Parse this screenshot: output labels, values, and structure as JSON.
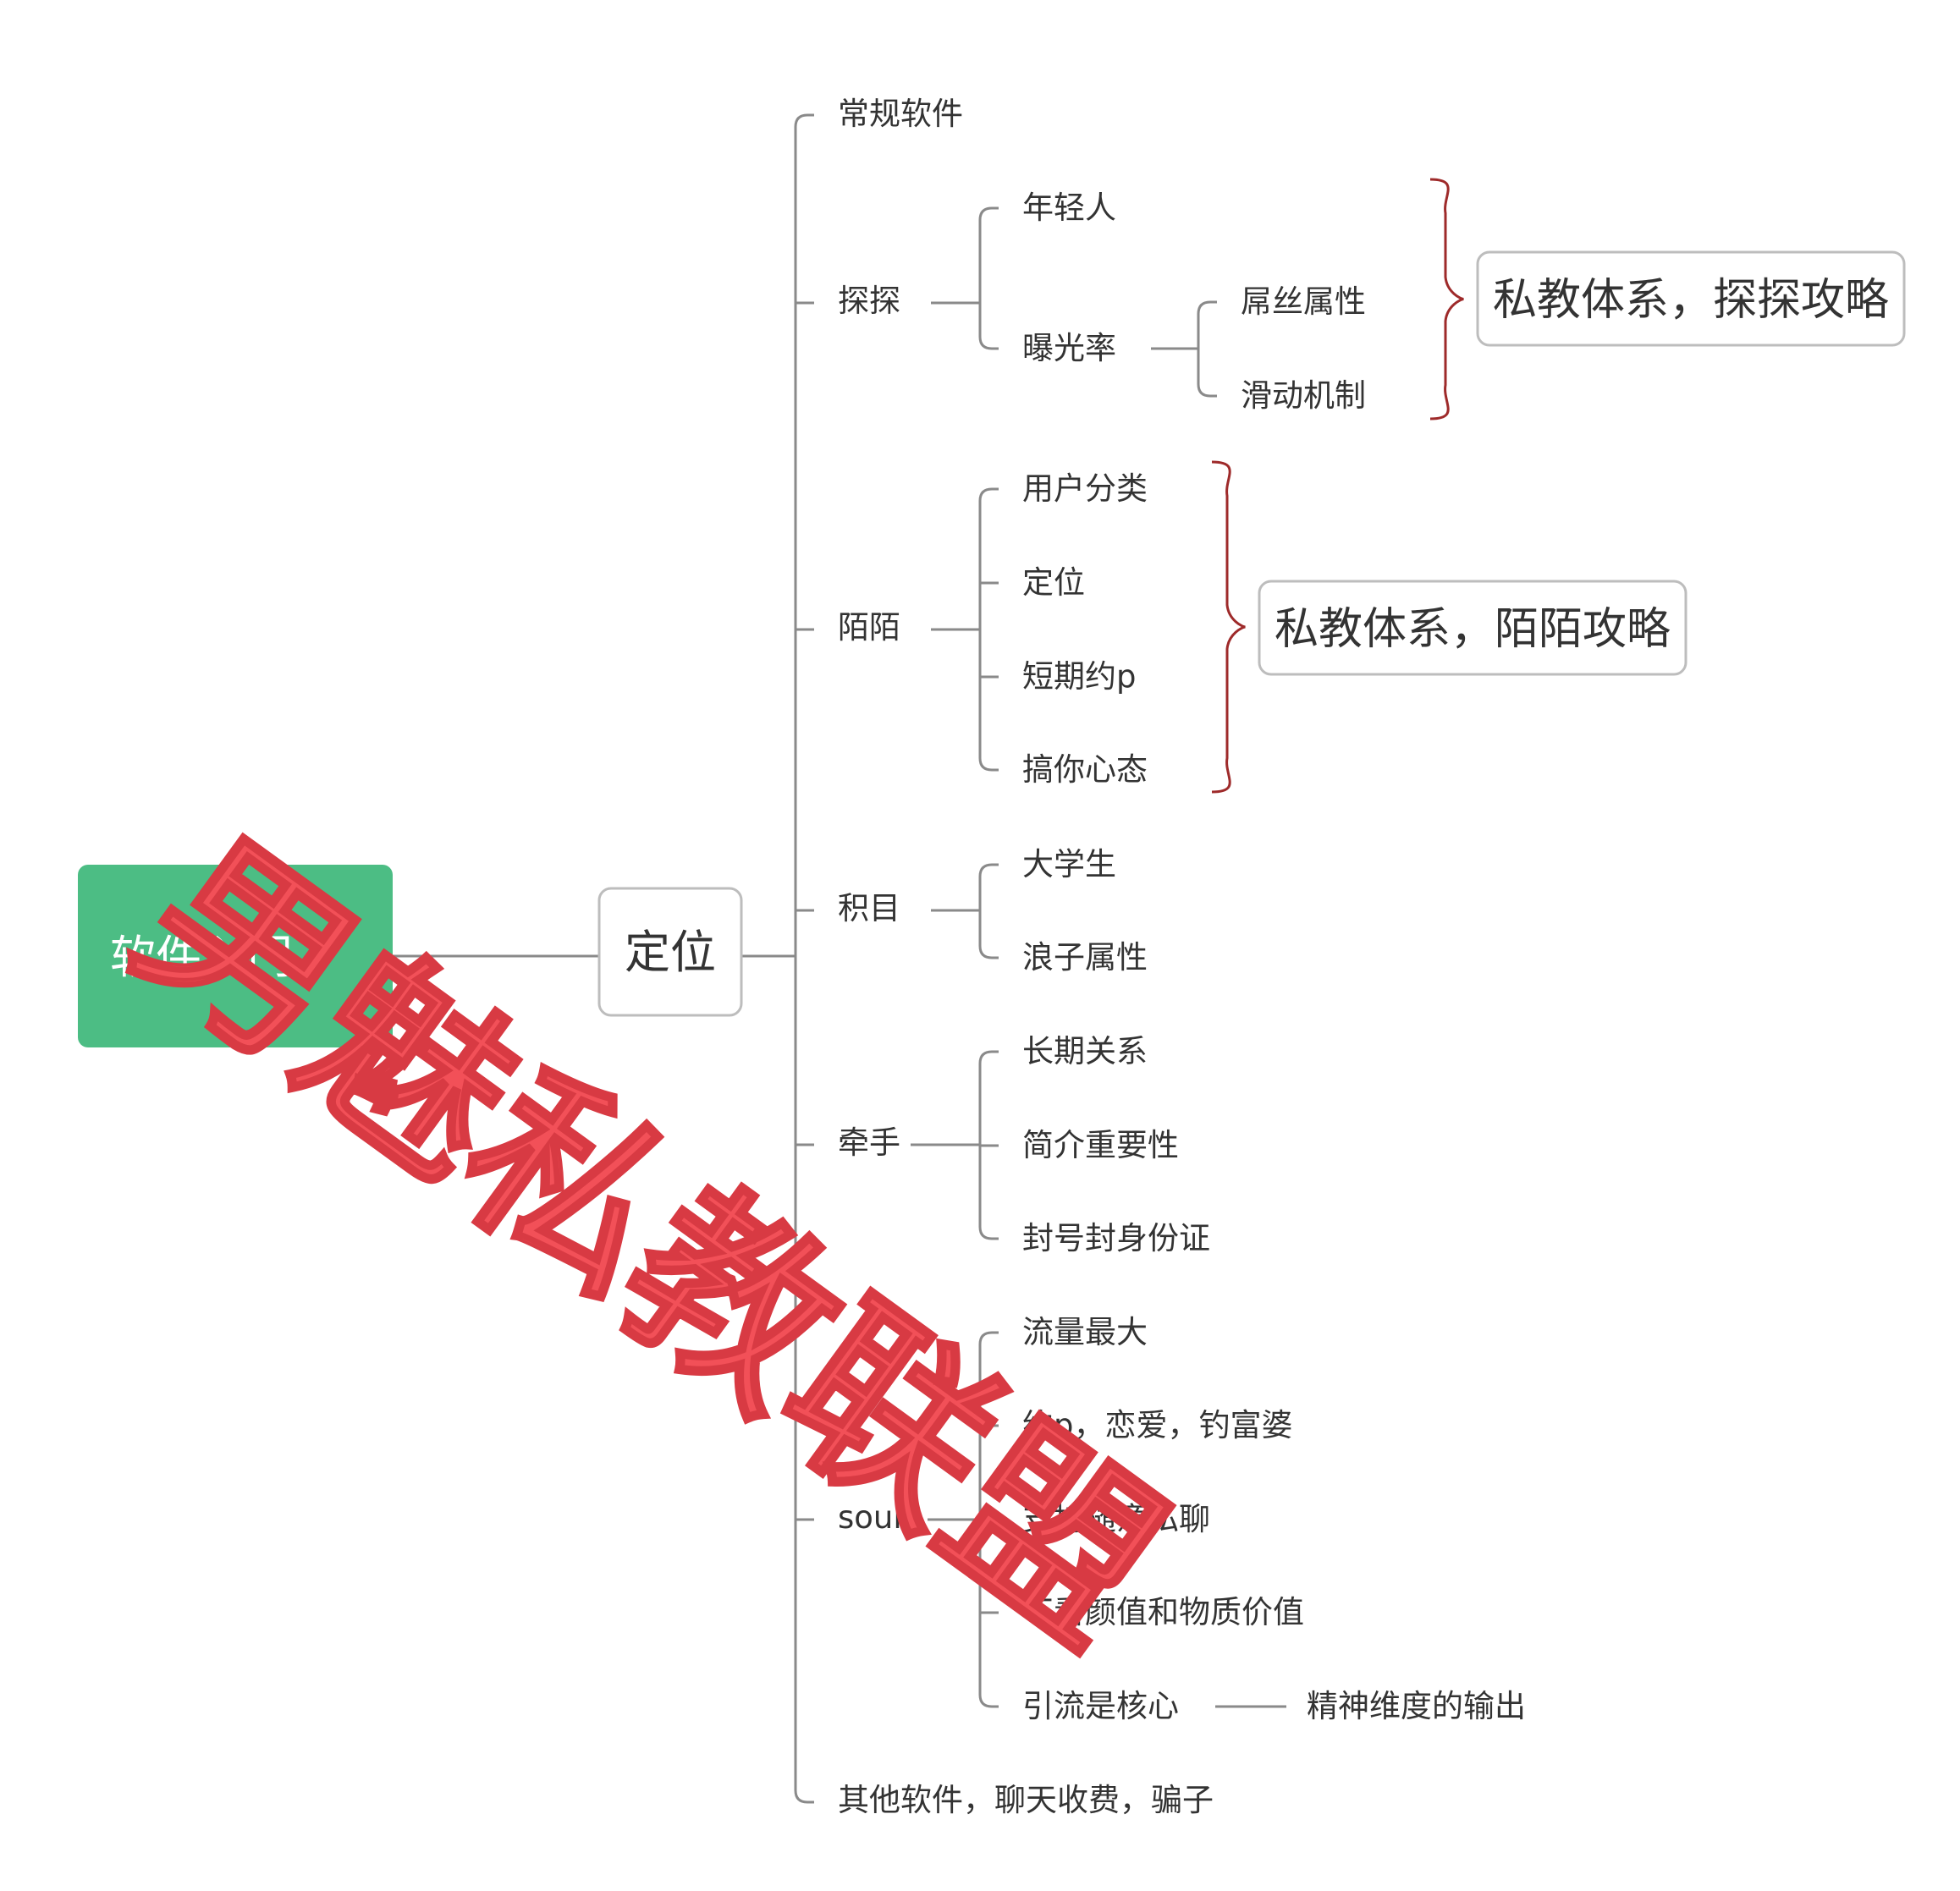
{
  "root": {
    "label": "软件入门"
  },
  "center": {
    "label": "定位"
  },
  "branches": [
    {
      "label": "常规软件",
      "children": []
    },
    {
      "label": "探探",
      "children": [
        {
          "label": "年轻人",
          "children": []
        },
        {
          "label": "曝光率",
          "children": [
            {
              "label": "屌丝属性"
            },
            {
              "label": "滑动机制"
            }
          ]
        }
      ]
    },
    {
      "label": "陌陌",
      "children": [
        {
          "label": "用户分类",
          "children": []
        },
        {
          "label": "定位",
          "children": []
        },
        {
          "label": "短期约p",
          "children": []
        },
        {
          "label": "搞你心态",
          "children": []
        }
      ]
    },
    {
      "label": "积目",
      "children": [
        {
          "label": "大学生",
          "children": []
        },
        {
          "label": "浪子属性",
          "children": []
        }
      ]
    },
    {
      "label": "牵手",
      "children": [
        {
          "label": "长期关系",
          "children": []
        },
        {
          "label": "简介重要性",
          "children": []
        },
        {
          "label": "封号封身份证",
          "children": []
        }
      ]
    },
    {
      "label": "soul",
      "children": [
        {
          "label": "流量最大",
          "children": []
        },
        {
          "label": "约p，恋爱，钓富婆",
          "children": []
        },
        {
          "label": "支持随意私聊",
          "children": []
        },
        {
          "label": "不看颜值和物质价值",
          "children": []
        },
        {
          "label": "引流是核心",
          "children": [
            {
              "label": "精神维度的输出"
            }
          ]
        }
      ]
    },
    {
      "label": "其他软件，聊天收费，骗子",
      "children": []
    }
  ],
  "summaries": [
    {
      "label": "私教体系，探探攻略"
    },
    {
      "label": "私教体系，陌陌攻略"
    }
  ],
  "watermark": {
    "text": "男魅私教联盟"
  },
  "colors": {
    "root_fill": "#4cbd84",
    "line": "#8a8a8a",
    "brace": "#9e2a2a",
    "watermark": "#f25058"
  }
}
